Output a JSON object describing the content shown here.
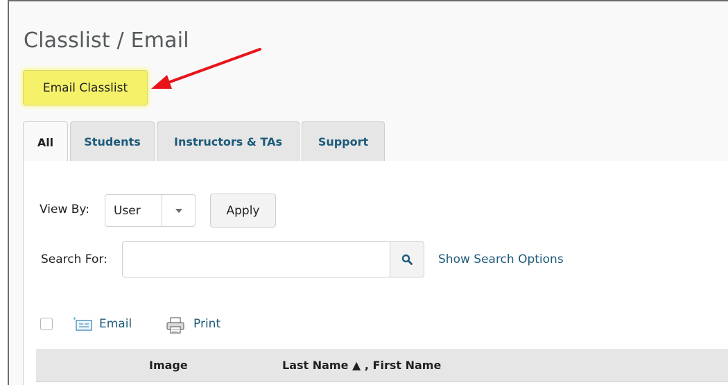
{
  "page": {
    "title": "Classlist / Email",
    "email_classlist_label": "Email Classlist"
  },
  "tabs": [
    {
      "label": "All",
      "active": true
    },
    {
      "label": "Students",
      "active": false
    },
    {
      "label": "Instructors & TAs",
      "active": false
    },
    {
      "label": "Support",
      "active": false
    }
  ],
  "filters": {
    "view_by_label": "View By:",
    "view_by_value": "User",
    "apply_label": "Apply",
    "search_for_label": "Search For:",
    "search_value": "",
    "show_search_options": "Show Search Options"
  },
  "actions": {
    "email_label": "Email",
    "print_label": "Print"
  },
  "table": {
    "columns": [
      "Image",
      "Last Name ▲ , First Name"
    ]
  },
  "colors": {
    "highlight": "#f5f26a",
    "link": "#1d5a7a",
    "annotation_arrow": "#e8141a"
  },
  "icons": {
    "arrow": "red-annotation-arrow",
    "search": "search-icon",
    "email": "email-icon",
    "print": "print-icon",
    "dropdown": "chevron-down-icon"
  }
}
